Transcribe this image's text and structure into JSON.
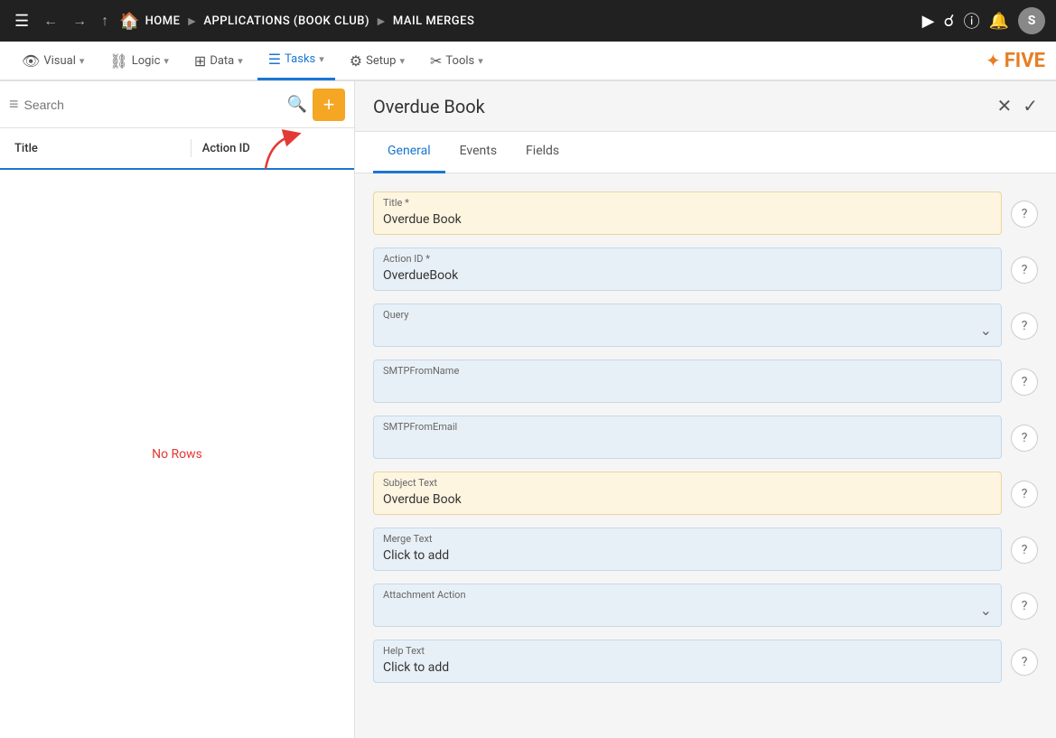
{
  "topNav": {
    "breadcrumbs": [
      "HOME",
      "APPLICATIONS (BOOK CLUB)",
      "MAIL MERGES"
    ],
    "avatarLetter": "S"
  },
  "menuBar": {
    "items": [
      {
        "id": "visual",
        "icon": "👁",
        "label": "Visual",
        "hasDropdown": true
      },
      {
        "id": "logic",
        "icon": "⛓",
        "label": "Logic",
        "hasDropdown": true
      },
      {
        "id": "data",
        "icon": "⊞",
        "label": "Data",
        "hasDropdown": true
      },
      {
        "id": "tasks",
        "icon": "☰",
        "label": "Tasks",
        "hasDropdown": true,
        "active": true
      },
      {
        "id": "setup",
        "icon": "⚙",
        "label": "Setup",
        "hasDropdown": true
      },
      {
        "id": "tools",
        "icon": "🔧",
        "label": "Tools",
        "hasDropdown": true
      }
    ]
  },
  "leftPanel": {
    "searchPlaceholder": "Search",
    "columns": [
      "Title",
      "Action ID"
    ],
    "noRowsText": "No Rows",
    "addButtonLabel": "+"
  },
  "rightPanel": {
    "title": "Overdue Book",
    "tabs": [
      "General",
      "Events",
      "Fields"
    ],
    "activeTab": "General",
    "form": {
      "titleLabel": "Title *",
      "titleValue": "Overdue Book",
      "actionIdLabel": "Action ID *",
      "actionIdValue": "OverdueBook",
      "queryLabel": "Query",
      "queryValue": "",
      "smtpFromNameLabel": "SMTPFromName",
      "smtpFromNameValue": "",
      "smtpFromEmailLabel": "SMTPFromEmail",
      "smtpFromEmailValue": "",
      "subjectTextLabel": "Subject Text",
      "subjectTextValue": "Overdue Book",
      "mergeTextLabel": "Merge Text",
      "mergeTextValue": "Click to add",
      "attachmentActionLabel": "Attachment Action",
      "attachmentActionValue": "",
      "helpTextLabel": "Help Text",
      "helpTextValue": "Click to add"
    }
  }
}
